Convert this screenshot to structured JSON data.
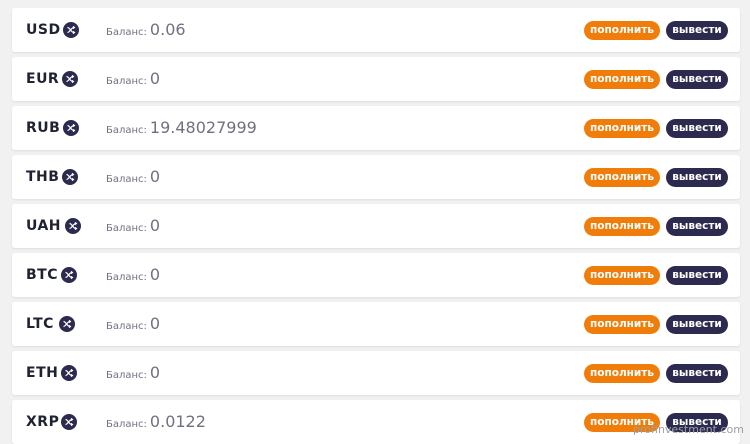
{
  "colors": {
    "deposit_button": "#f07d0a",
    "withdraw_button": "#2c2a4e",
    "exchange_icon": "#2c2a4e",
    "row_background": "#ffffff",
    "page_background": "#f1f1f1"
  },
  "icons": {
    "exchange": "exchange-icon"
  },
  "balance_label": "Баланс:",
  "deposit_label": "пополнить",
  "withdraw_label": "вывести",
  "currencies": [
    {
      "code": "USD",
      "balance": "0.06"
    },
    {
      "code": "EUR",
      "balance": "0"
    },
    {
      "code": "RUB",
      "balance": "19.48027999"
    },
    {
      "code": "THB",
      "balance": "0"
    },
    {
      "code": "UAH",
      "balance": "0"
    },
    {
      "code": "BTC",
      "balance": "0"
    },
    {
      "code": "LTC",
      "balance": "0"
    },
    {
      "code": "ETH",
      "balance": "0"
    },
    {
      "code": "XRP",
      "balance": "0.0122"
    }
  ],
  "watermark": "profinvestment.com"
}
